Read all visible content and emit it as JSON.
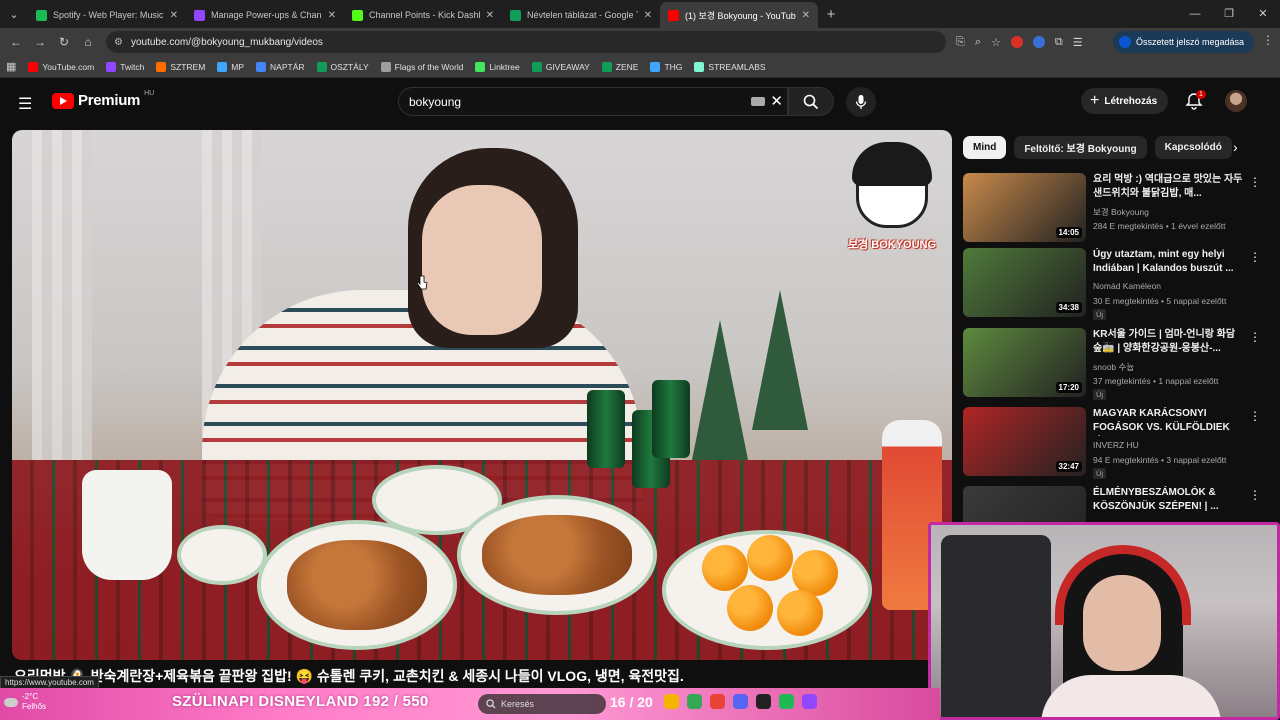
{
  "browser": {
    "tabs": [
      {
        "title": "Spotify - Web Player: Music for",
        "color": "#1db954",
        "active": false
      },
      {
        "title": "Manage Power-ups & Channel",
        "color": "#9146ff",
        "active": false
      },
      {
        "title": "Channel Points - Kick Dashboa",
        "color": "#53fc18",
        "active": false
      },
      {
        "title": "Névtelen táblázat - Google Tábl",
        "color": "#0f9d58",
        "active": false
      },
      {
        "title": "(1) 보경 Bokyoung - YouTube",
        "color": "#ff0000",
        "active": true
      }
    ],
    "address": "youtube.com/@bokyoung_mukbang/videos",
    "password_button": "Összetett jelszó megadása",
    "bookmarks": [
      {
        "label": "YouTube.com",
        "color": "#ff0000"
      },
      {
        "label": "Twitch",
        "color": "#9146ff"
      },
      {
        "label": "SZTREM",
        "color": "#ff6d00"
      },
      {
        "label": "MP",
        "color": "#3ea6ff"
      },
      {
        "label": "NAPTÁR",
        "color": "#4285f4"
      },
      {
        "label": "OSZTÁLY",
        "color": "#0f9d58"
      },
      {
        "label": "Flags of the World",
        "color": "#9e9e9e"
      },
      {
        "label": "Linktree",
        "color": "#43e660"
      },
      {
        "label": "GIVEAWAY",
        "color": "#0f9d58"
      },
      {
        "label": "ZENE",
        "color": "#0f9d58"
      },
      {
        "label": "THG",
        "color": "#3ea6ff"
      },
      {
        "label": "STREAMLABS",
        "color": "#80f5d2"
      }
    ],
    "status_url": "https://www.youtube.com"
  },
  "youtube": {
    "logo": "Premium",
    "logo_region": "HU",
    "search_value": "bokyoung",
    "create_label": "Létrehozás",
    "notification_count": "1",
    "video_title": "요리먹방 🍳 반숙계란장+제육볶음 끝판왕 집밥! 😝 슈톨렌 쿠키, 교촌치킨 & 세종시 나들이 VLOG, 냉면, 육전맛집.",
    "channel_badge_text": "보경 BOKYOUNG",
    "chips": [
      "Mind",
      "Feltöltő: 보경 Bokyoung",
      "Kapcsolódó"
    ],
    "recommendations": [
      {
        "title": "요리 먹방 :) 역대급으로 맛있는 자두샌드위치와 불닭김밥, 매...",
        "channel": "보경 Bokyoung",
        "meta": "284 E megtekintés • 1 évvel ezelőtt",
        "duration": "14:05",
        "badge": "",
        "thumb": "#c98a4b"
      },
      {
        "title": "Úgy utaztam, mint egy helyi Indiában | Kalandos buszút ...",
        "channel": "Nomád Kaméleon",
        "meta": "30 E megtekintés • 5 nappal ezelőtt",
        "duration": "34:38",
        "badge": "Új",
        "thumb": "#4f7a3a"
      },
      {
        "title": "KR서울 가이드 | 엄마-언니랑 화담숲🚋 | 양화한강공원-응봉산-...",
        "channel": "snoob 수늅",
        "meta": "37 megtekintés • 1 nappal ezelőtt",
        "duration": "17:20",
        "badge": "Új",
        "thumb": "#5e8a3e"
      },
      {
        "title": "MAGYAR KARÁCSONYI FOGÁSOK VS. KÜLFÖLDIEK 🎄",
        "channel": "INVERZ HU",
        "meta": "94 E megtekintés • 3 nappal ezelőtt",
        "duration": "32:47",
        "badge": "Új",
        "thumb": "#b02424"
      },
      {
        "title": "ÉLMÉNYBESZÁMOLÓK & KÖSZÖNJÜK SZÉPEN! | ...",
        "channel": "",
        "meta": "",
        "duration": "",
        "badge": "",
        "thumb": "#3a3a3a"
      }
    ]
  },
  "overlay": {
    "weather_temp": "-2°C",
    "weather_desc": "Felhős",
    "stream_goal": "SZÜLINAPI DISNEYLAND  192 / 550",
    "taskbar_search": "Keresés",
    "sub_goal": "16 / 20"
  }
}
